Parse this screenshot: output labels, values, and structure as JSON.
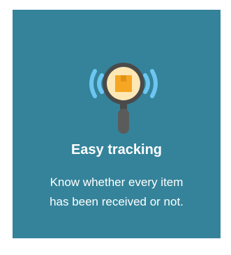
{
  "card": {
    "title": "Easy tracking",
    "description_lines": [
      "Know whether every item",
      "has been received or not."
    ],
    "background_color": "#34839a"
  },
  "icon": {
    "name": "magnifier-package-icon",
    "colors": {
      "waves": "#6cc6f0",
      "ring": "#4a4a4a",
      "glass": "#fde7b4",
      "box": "#f5a623",
      "box_dark": "#e09218",
      "handle": "#5b5b5b"
    }
  }
}
